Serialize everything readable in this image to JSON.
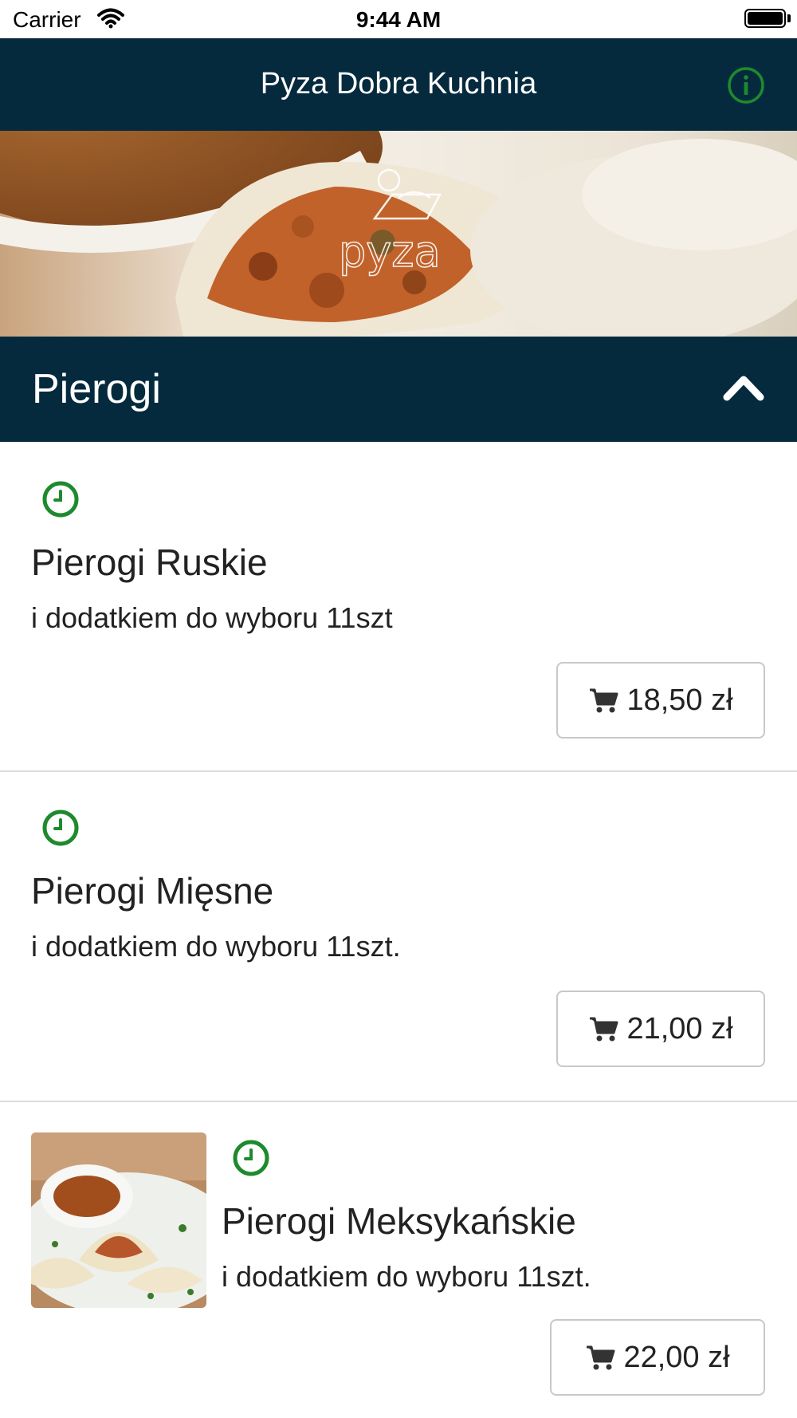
{
  "status_bar": {
    "carrier": "Carrier",
    "time": "9:44 AM"
  },
  "nav": {
    "title": "Pyza Dobra Kuchnia"
  },
  "category": {
    "title": "Pierogi"
  },
  "items": [
    {
      "name": "Pierogi Ruskie",
      "description": "i dodatkiem do wyboru 11szt",
      "price": "18,50 zł"
    },
    {
      "name": "Pierogi Mięsne",
      "description": "i dodatkiem do wyboru 11szt.",
      "price": "21,00 zł"
    },
    {
      "name": "Pierogi Meksykańskie",
      "description": "i dodatkiem do wyboru 11szt.",
      "price": "22,00 zł"
    }
  ],
  "colors": {
    "navy": "#052a3d",
    "accent_green": "#1e8a2e",
    "border": "#c8c8c8"
  }
}
